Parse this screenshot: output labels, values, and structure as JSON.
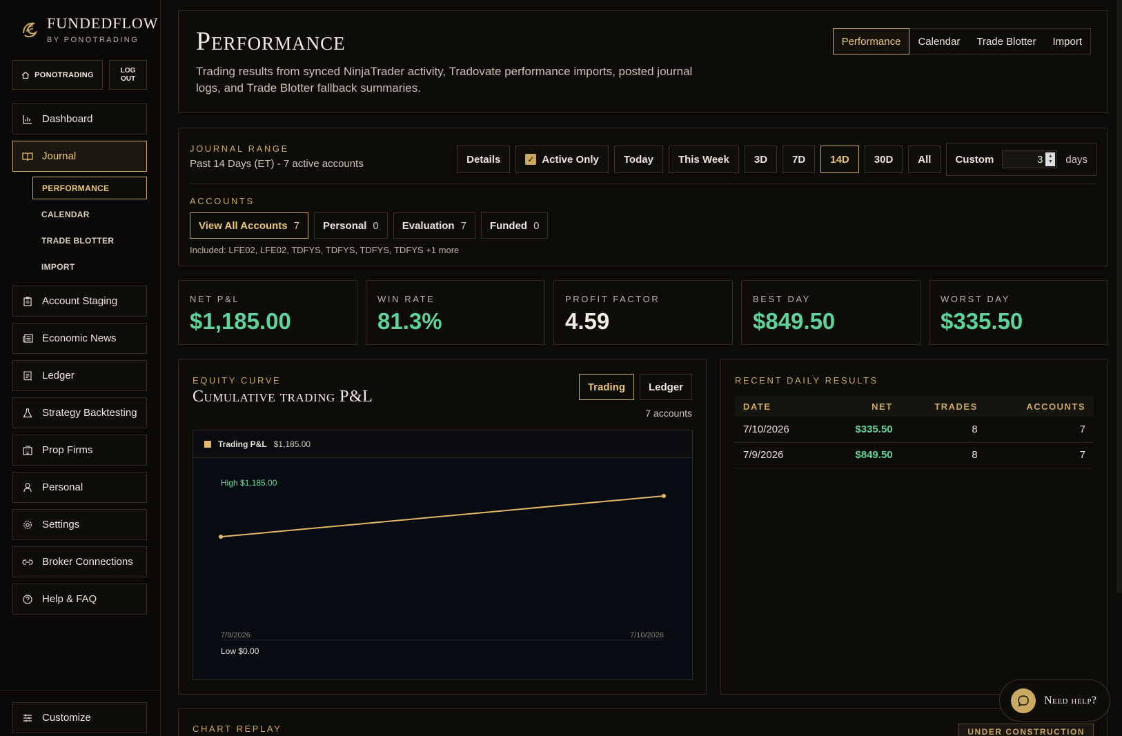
{
  "brand": {
    "name": "FUNDEDFLOW",
    "sub": "BY PONOTRADING"
  },
  "top_buttons": {
    "home": "PONOTRADING",
    "logout_line1": "LOG",
    "logout_line2": "OUT"
  },
  "nav": {
    "dashboard": "Dashboard",
    "journal": "Journal",
    "sub": [
      "PERFORMANCE",
      "CALENDAR",
      "TRADE BLOTTER",
      "IMPORT"
    ],
    "account_staging": "Account Staging",
    "economic_news": "Economic News",
    "ledger": "Ledger",
    "strategy_backtesting": "Strategy Backtesting",
    "prop_firms": "Prop Firms",
    "personal": "Personal",
    "settings": "Settings",
    "broker_connections": "Broker Connections",
    "help_faq": "Help & FAQ",
    "customize": "Customize"
  },
  "header": {
    "title": "Performance",
    "description": "Trading results from synced NinjaTrader activity, Tradovate performance imports, posted journal logs, and Trade Blotter fallback summaries.",
    "tabs": [
      "Performance",
      "Calendar",
      "Trade Blotter",
      "Import"
    ]
  },
  "range": {
    "label": "JOURNAL RANGE",
    "text": "Past 14 Days (ET) - 7 active accounts",
    "details": "Details",
    "active_only": "Active Only",
    "today": "Today",
    "this_week": "This Week",
    "d3": "3D",
    "d7": "7D",
    "d14": "14D",
    "d30": "30D",
    "all": "All",
    "custom": "Custom",
    "custom_value": "3",
    "days": "days"
  },
  "accounts": {
    "label": "ACCOUNTS",
    "items": [
      {
        "label": "View All Accounts",
        "count": "7"
      },
      {
        "label": "Personal",
        "count": "0"
      },
      {
        "label": "Evaluation",
        "count": "7"
      },
      {
        "label": "Funded",
        "count": "0"
      }
    ],
    "included": "Included: LFE02, LFE02, TDFYS, TDFYS, TDFYS, TDFYS +1 more"
  },
  "stats": [
    {
      "label": "NET P&L",
      "value": "$1,185.00"
    },
    {
      "label": "WIN RATE",
      "value": "81.3%"
    },
    {
      "label": "PROFIT FACTOR",
      "value": "4.59"
    },
    {
      "label": "BEST DAY",
      "value": "$849.50"
    },
    {
      "label": "WORST DAY",
      "value": "$335.50"
    }
  ],
  "equity": {
    "label": "EQUITY CURVE",
    "title": "Cumulative trading P&L",
    "tab_trading": "Trading",
    "tab_ledger": "Ledger",
    "accounts": "7 accounts",
    "legend_name": "Trading P&L",
    "legend_value": "$1,185.00",
    "high": "High $1,185.00",
    "low": "Low $0.00",
    "x_start": "7/9/2026",
    "x_end": "7/10/2026"
  },
  "chart_data": {
    "type": "line",
    "x": [
      "7/9/2026",
      "7/10/2026"
    ],
    "series": [
      {
        "name": "Trading P&L",
        "values": [
          849.5,
          1185.0
        ]
      }
    ],
    "ylim": [
      0,
      1185
    ],
    "color": "#e6b96a"
  },
  "recent": {
    "label": "RECENT DAILY RESULTS",
    "headers": [
      "DATE",
      "NET",
      "TRADES",
      "ACCOUNTS"
    ],
    "rows": [
      {
        "date": "7/10/2026",
        "net": "$335.50",
        "trades": "8",
        "accounts": "7"
      },
      {
        "date": "7/9/2026",
        "net": "$849.50",
        "trades": "8",
        "accounts": "7"
      }
    ]
  },
  "replay": {
    "label": "CHART REPLAY",
    "badge": "UNDER CONSTRUCTION"
  },
  "help": "Need help?"
}
